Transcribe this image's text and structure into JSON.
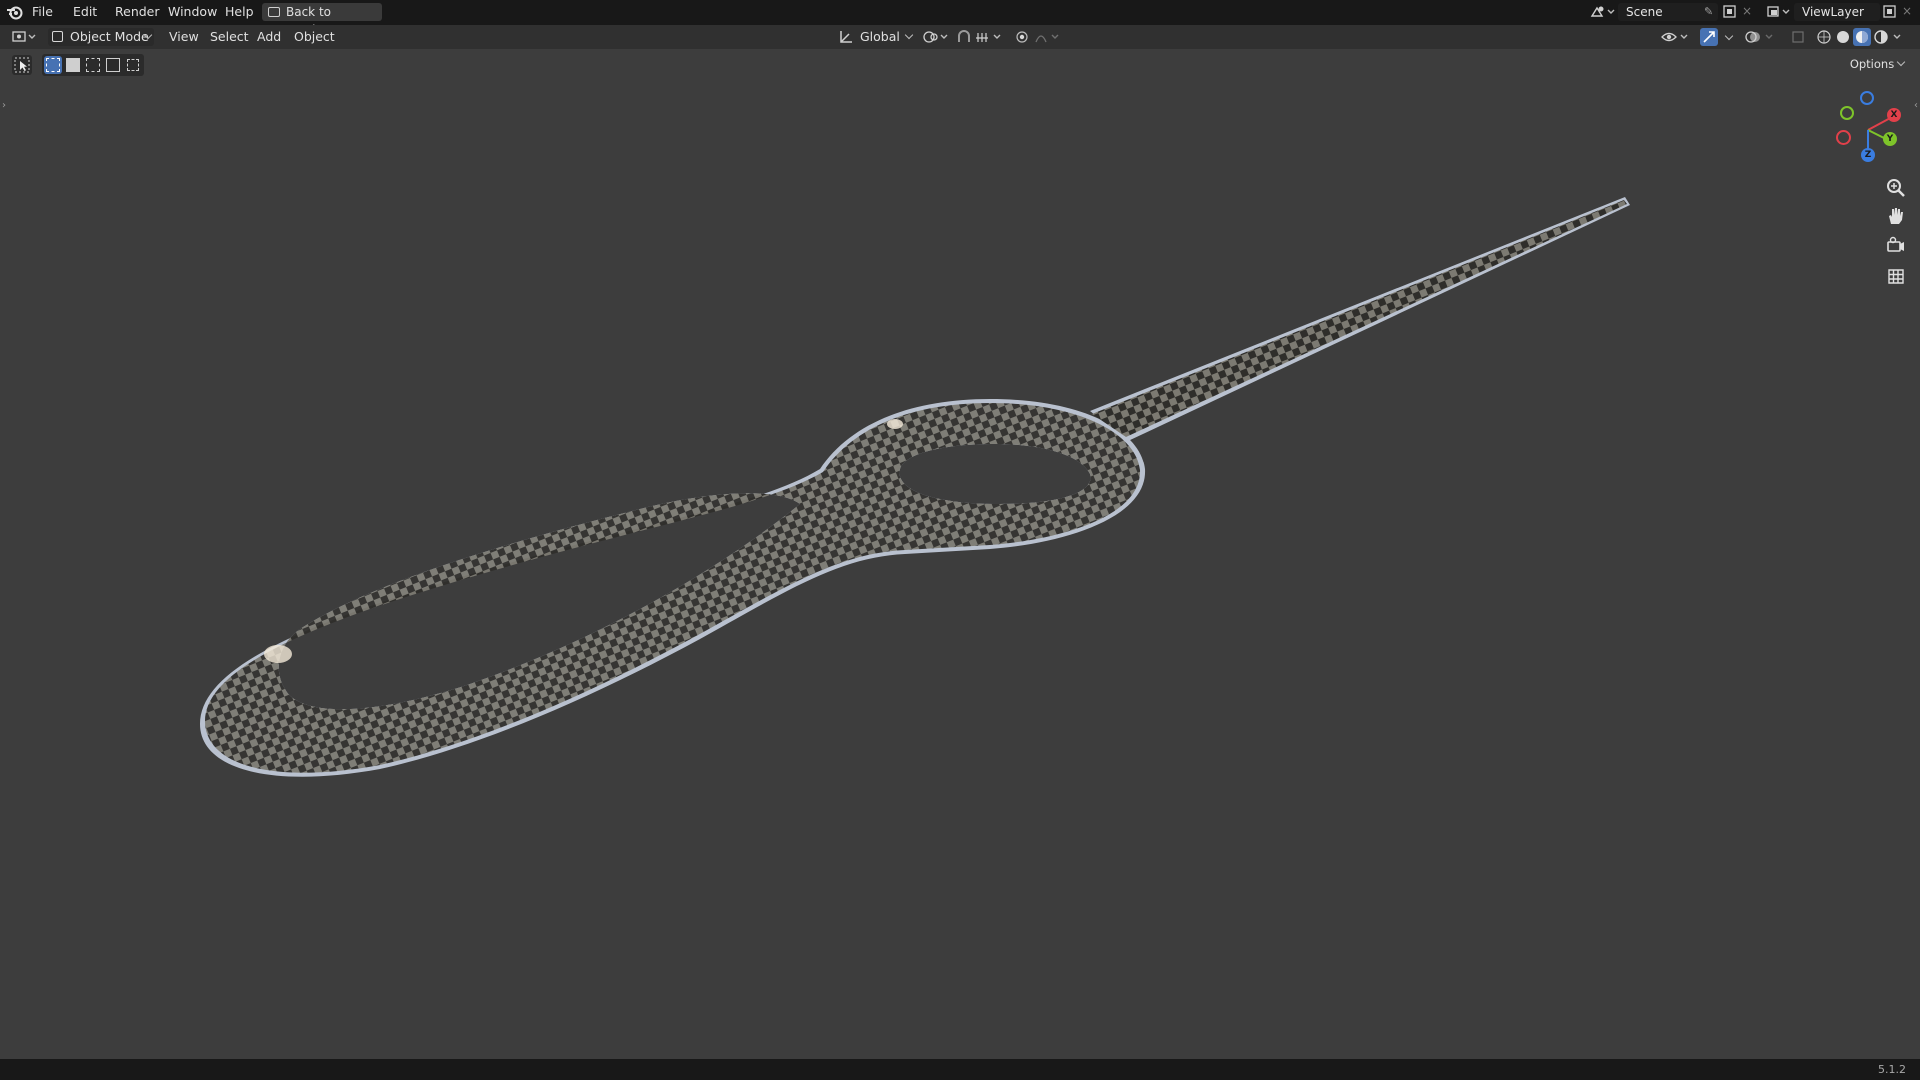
{
  "topbar": {
    "menus": [
      "File",
      "Edit",
      "Render",
      "Window",
      "Help"
    ],
    "back_button": "Back to Previous",
    "scene_name": "Scene",
    "view_layer_name": "ViewLayer"
  },
  "header": {
    "mode": "Object Mode",
    "menus": [
      "View",
      "Select",
      "Add",
      "Object"
    ],
    "transform_orientation": "Global"
  },
  "viewport": {
    "options_label": "Options",
    "gizmo_axes": [
      "X",
      "Y",
      "Z"
    ],
    "object": "checker-textured curved tube with loop",
    "colors": {
      "background": "#3d3d3d",
      "axis_x": "#e2404a",
      "axis_y": "#7ec42a",
      "axis_z": "#3a7de0",
      "active_blue": "#4772b3"
    }
  },
  "statusbar": {
    "version": "5.1.2"
  },
  "icons": [
    "blender-logo-icon",
    "editor-type-icon",
    "object-mode-icon",
    "select-box-icon",
    "transform-icon",
    "snap-icon",
    "proportional-icon",
    "zoom-icon",
    "pan-hand-icon",
    "camera-icon",
    "grid-icon"
  ]
}
